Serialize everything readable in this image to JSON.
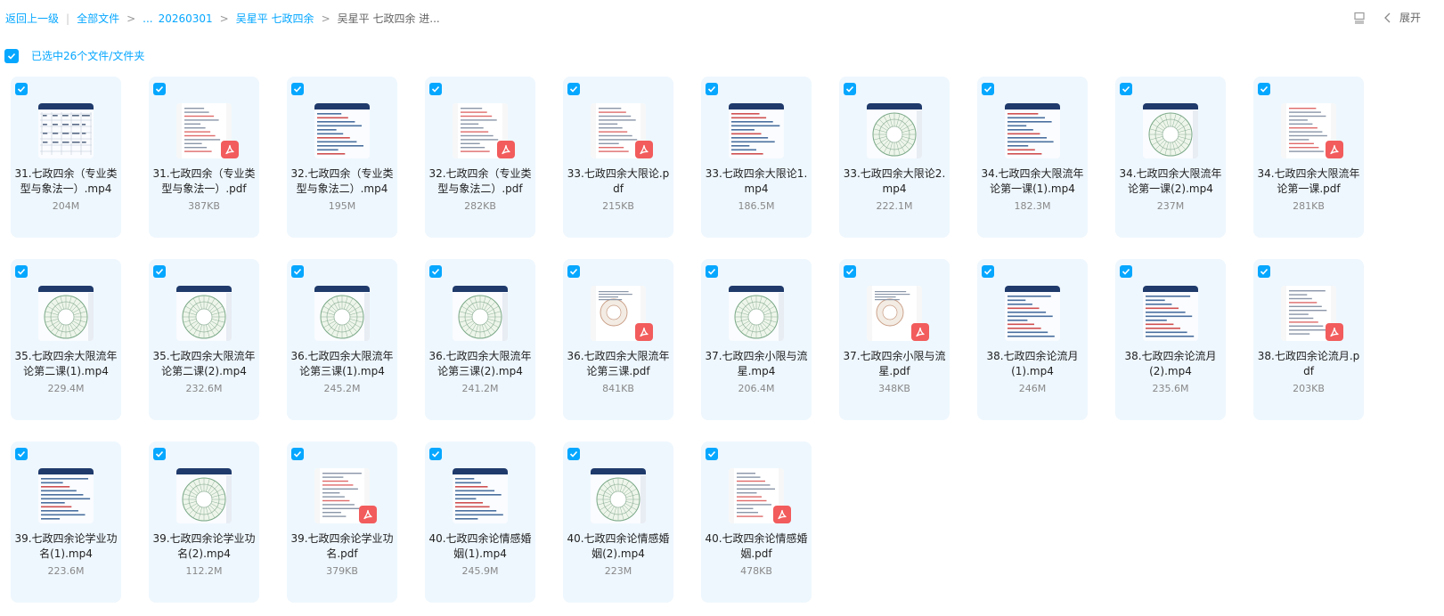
{
  "breadcrumb": {
    "back": "返回上一级",
    "root": "全部文件",
    "ellipsis": "...",
    "folder1": "20260301",
    "folder2": "吴星平 七政四余",
    "current": "吴星平 七政四余 进..."
  },
  "toolbar": {
    "expand_label": "展开"
  },
  "selection": {
    "label": "已选中26个文件/文件夹"
  },
  "colors": {
    "accent": "#06a7ff",
    "card_bg": "#eef7fe",
    "pdf_badge": "#f25c5c"
  },
  "files": [
    {
      "name": "31.七政四余（专业类型与象法一）.mp4",
      "size": "204M",
      "type": "video",
      "thumb": "table"
    },
    {
      "name": "31.七政四余（专业类型与象法一）.pdf",
      "size": "387KB",
      "type": "pdf",
      "thumb": "doc"
    },
    {
      "name": "32.七政四余（专业类型与象法二）.mp4",
      "size": "195M",
      "type": "video",
      "thumb": "text"
    },
    {
      "name": "32.七政四余（专业类型与象法二）.pdf",
      "size": "282KB",
      "type": "pdf",
      "thumb": "doc"
    },
    {
      "name": "33.七政四余大限论.pdf",
      "size": "215KB",
      "type": "pdf",
      "thumb": "doc"
    },
    {
      "name": "33.七政四余大限论1.mp4",
      "size": "186.5M",
      "type": "video",
      "thumb": "text"
    },
    {
      "name": "33.七政四余大限论2.mp4",
      "size": "222.1M",
      "type": "video",
      "thumb": "wheel"
    },
    {
      "name": "34.七政四余大限流年论第一课(1).mp4",
      "size": "182.3M",
      "type": "video",
      "thumb": "text"
    },
    {
      "name": "34.七政四余大限流年论第一课(2).mp4",
      "size": "237M",
      "type": "video",
      "thumb": "wheel"
    },
    {
      "name": "34.七政四余大限流年论第一课.pdf",
      "size": "281KB",
      "type": "pdf",
      "thumb": "doc"
    },
    {
      "name": "35.七政四余大限流年论第二课(1).mp4",
      "size": "229.4M",
      "type": "video",
      "thumb": "wheel"
    },
    {
      "name": "35.七政四余大限流年论第二课(2).mp4",
      "size": "232.6M",
      "type": "video",
      "thumb": "wheel"
    },
    {
      "name": "36.七政四余大限流年论第三课(1).mp4",
      "size": "245.2M",
      "type": "video",
      "thumb": "wheel"
    },
    {
      "name": "36.七政四余大限流年论第三课(2).mp4",
      "size": "241.2M",
      "type": "video",
      "thumb": "wheel"
    },
    {
      "name": "36.七政四余大限流年论第三课.pdf",
      "size": "841KB",
      "type": "pdf",
      "thumb": "wheeldoc"
    },
    {
      "name": "37.七政四余小限与流星.mp4",
      "size": "206.4M",
      "type": "video",
      "thumb": "wheel"
    },
    {
      "name": "37.七政四余小限与流星.pdf",
      "size": "348KB",
      "type": "pdf",
      "thumb": "wheeldoc"
    },
    {
      "name": "38.七政四余论流月(1).mp4",
      "size": "246M",
      "type": "video",
      "thumb": "text"
    },
    {
      "name": "38.七政四余论流月(2).mp4",
      "size": "235.6M",
      "type": "video",
      "thumb": "text"
    },
    {
      "name": "38.七政四余论流月.pdf",
      "size": "203KB",
      "type": "pdf",
      "thumb": "doc"
    },
    {
      "name": "39.七政四余论学业功名(1).mp4",
      "size": "223.6M",
      "type": "video",
      "thumb": "text"
    },
    {
      "name": "39.七政四余论学业功名(2).mp4",
      "size": "112.2M",
      "type": "video",
      "thumb": "wheel"
    },
    {
      "name": "39.七政四余论学业功名.pdf",
      "size": "379KB",
      "type": "pdf",
      "thumb": "doc"
    },
    {
      "name": "40.七政四余论情感婚姻(1).mp4",
      "size": "245.9M",
      "type": "video",
      "thumb": "text"
    },
    {
      "name": "40.七政四余论情感婚姻(2).mp4",
      "size": "223M",
      "type": "video",
      "thumb": "wheel"
    },
    {
      "name": "40.七政四余论情感婚姻.pdf",
      "size": "478KB",
      "type": "pdf",
      "thumb": "doc"
    }
  ]
}
